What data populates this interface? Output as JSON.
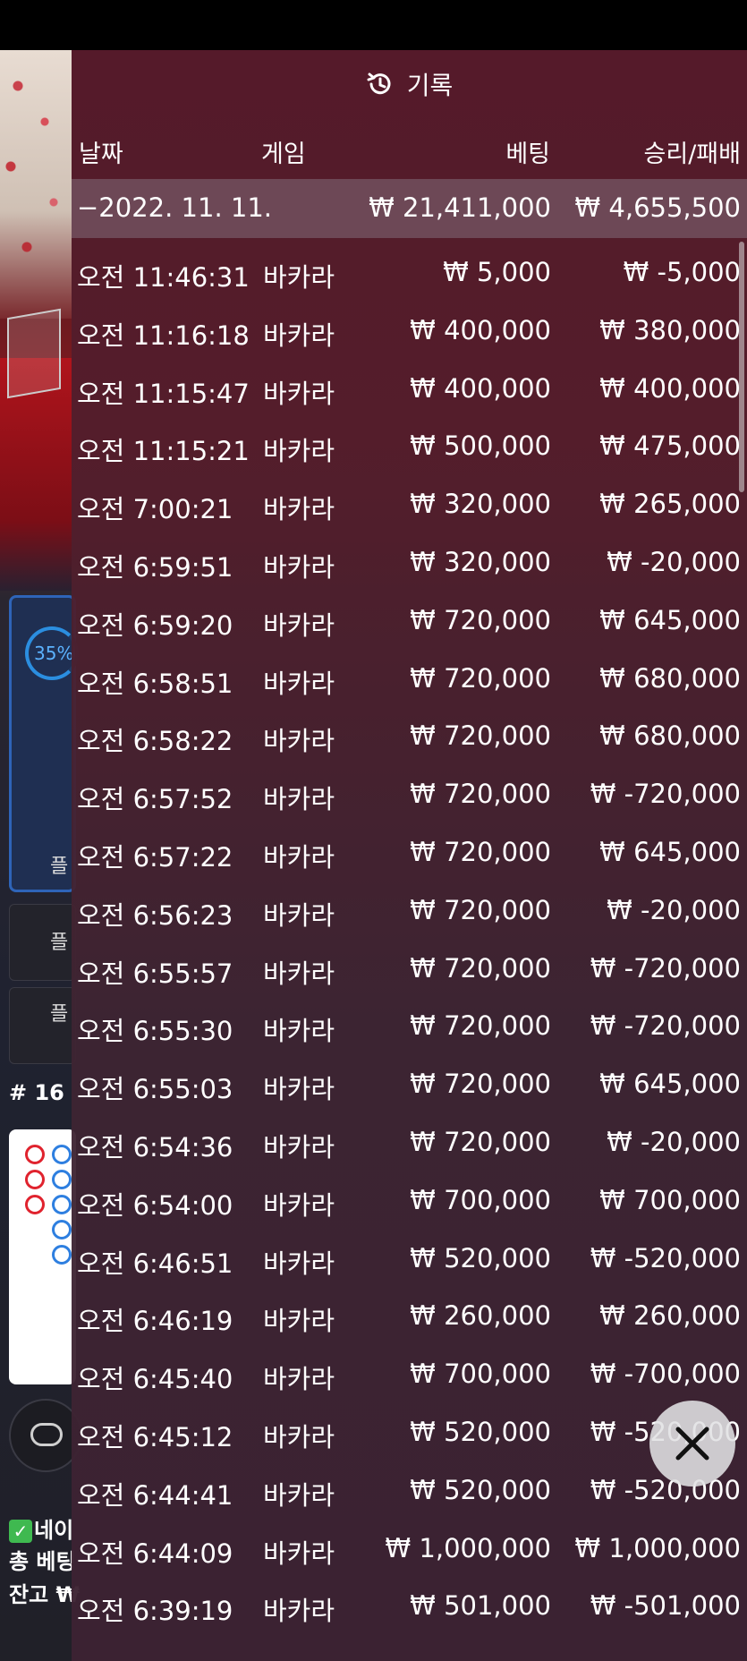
{
  "history": {
    "title": "기록",
    "columns": {
      "date": "날짜",
      "game": "게임",
      "bet": "베팅",
      "win_loss": "승리/패배"
    },
    "date_group": {
      "date": "−2022. 11. 11.",
      "bet_total": "₩ 21,411,000",
      "win_total": "₩ 4,655,500"
    },
    "rows": [
      {
        "time": "오전 11:46:31",
        "game": "바카라",
        "bet": "₩ 5,000",
        "result": "₩ -5,000"
      },
      {
        "time": "오전 11:16:18",
        "game": "바카라",
        "bet": "₩ 400,000",
        "result": "₩ 380,000"
      },
      {
        "time": "오전 11:15:47",
        "game": "바카라",
        "bet": "₩ 400,000",
        "result": "₩ 400,000"
      },
      {
        "time": "오전 11:15:21",
        "game": "바카라",
        "bet": "₩ 500,000",
        "result": "₩ 475,000"
      },
      {
        "time": "오전 7:00:21",
        "game": "바카라",
        "bet": "₩ 320,000",
        "result": "₩ 265,000"
      },
      {
        "time": "오전 6:59:51",
        "game": "바카라",
        "bet": "₩ 320,000",
        "result": "₩ -20,000"
      },
      {
        "time": "오전 6:59:20",
        "game": "바카라",
        "bet": "₩ 720,000",
        "result": "₩ 645,000"
      },
      {
        "time": "오전 6:58:51",
        "game": "바카라",
        "bet": "₩ 720,000",
        "result": "₩ 680,000"
      },
      {
        "time": "오전 6:58:22",
        "game": "바카라",
        "bet": "₩ 720,000",
        "result": "₩ 680,000"
      },
      {
        "time": "오전 6:57:52",
        "game": "바카라",
        "bet": "₩ 720,000",
        "result": "₩ -720,000"
      },
      {
        "time": "오전 6:57:22",
        "game": "바카라",
        "bet": "₩ 720,000",
        "result": "₩ 645,000"
      },
      {
        "time": "오전 6:56:23",
        "game": "바카라",
        "bet": "₩ 720,000",
        "result": "₩ -20,000"
      },
      {
        "time": "오전 6:55:57",
        "game": "바카라",
        "bet": "₩ 720,000",
        "result": "₩ -720,000"
      },
      {
        "time": "오전 6:55:30",
        "game": "바카라",
        "bet": "₩ 720,000",
        "result": "₩ -720,000"
      },
      {
        "time": "오전 6:55:03",
        "game": "바카라",
        "bet": "₩ 720,000",
        "result": "₩ 645,000"
      },
      {
        "time": "오전 6:54:36",
        "game": "바카라",
        "bet": "₩ 720,000",
        "result": "₩ -20,000"
      },
      {
        "time": "오전 6:54:00",
        "game": "바카라",
        "bet": "₩ 700,000",
        "result": "₩ 700,000"
      },
      {
        "time": "오전 6:46:51",
        "game": "바카라",
        "bet": "₩ 520,000",
        "result": "₩ -520,000"
      },
      {
        "time": "오전 6:46:19",
        "game": "바카라",
        "bet": "₩ 260,000",
        "result": "₩ 260,000"
      },
      {
        "time": "오전 6:45:40",
        "game": "바카라",
        "bet": "₩ 700,000",
        "result": "₩ -700,000"
      },
      {
        "time": "오전 6:45:12",
        "game": "바카라",
        "bet": "₩ 520,000",
        "result": "₩ -520,000"
      },
      {
        "time": "오전 6:44:41",
        "game": "바카라",
        "bet": "₩ 520,000",
        "result": "₩ -520,000"
      },
      {
        "time": "오전 6:44:09",
        "game": "바카라",
        "bet": "₩ 1,000,000",
        "result": "₩ 1,000,000"
      },
      {
        "time": "오전 6:39:19",
        "game": "바카라",
        "bet": "₩ 501,000",
        "result": "₩ -501,000"
      }
    ]
  },
  "background": {
    "percent": "35%",
    "side_label": "플",
    "round": "# 16",
    "line1": "네이",
    "line2": "총 베팅",
    "line3": "잔고 ₩"
  },
  "icons": {
    "history": "history-clock-icon",
    "close": "close-icon",
    "check": "check-icon",
    "chip": "chip-icon"
  },
  "colors": {
    "overlay": "#561a2a",
    "date_row": "#826e7a",
    "accent_blue": "#2b8ee0",
    "check_green": "#3fb950"
  }
}
